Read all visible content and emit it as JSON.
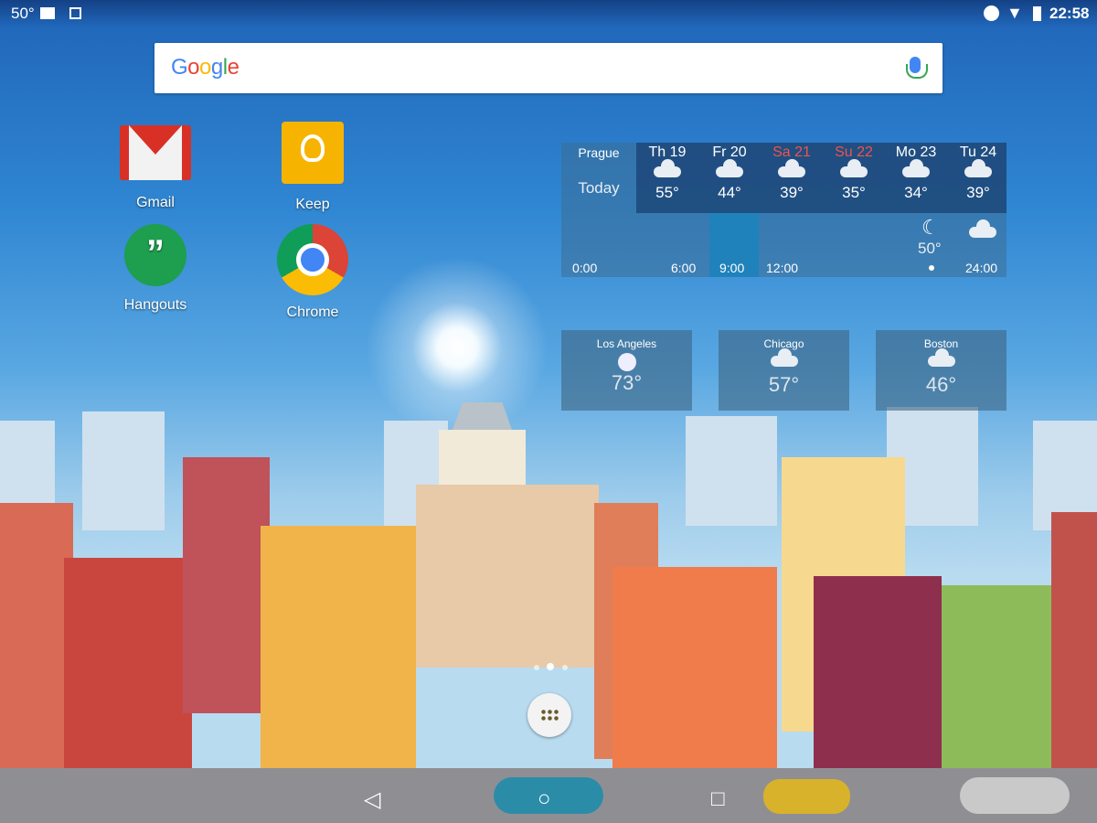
{
  "status_bar": {
    "temperature": "50°",
    "time": "22:58",
    "icons": [
      "gmail-notification-icon",
      "image-notification-icon",
      "do-not-disturb-icon",
      "wifi-icon",
      "battery-icon"
    ]
  },
  "search": {
    "logo": "Google",
    "icon": "mic-icon"
  },
  "apps": [
    {
      "label": "Gmail"
    },
    {
      "label": "Keep"
    },
    {
      "label": "Hangouts"
    },
    {
      "label": "Chrome"
    }
  ],
  "weather": {
    "city": "Prague",
    "today": "Today",
    "days": [
      {
        "label": "Th 19",
        "temp": "55°",
        "icon": "rain",
        "weekend": false
      },
      {
        "label": "Fr 20",
        "temp": "44°",
        "icon": "rain",
        "weekend": false
      },
      {
        "label": "Sa 21",
        "temp": "39°",
        "icon": "cloud",
        "weekend": true
      },
      {
        "label": "Su 22",
        "temp": "35°",
        "icon": "partly-sunny",
        "weekend": true
      },
      {
        "label": "Mo 23",
        "temp": "34°",
        "icon": "cloud",
        "weekend": false
      },
      {
        "label": "Tu 24",
        "temp": "39°",
        "icon": "cloud",
        "weekend": false
      }
    ],
    "now_temp": "50°",
    "hours": [
      "0:00",
      "6:00",
      "9:00",
      "12:00",
      "24:00"
    ],
    "weekend_color": "#ef5350"
  },
  "cities": [
    {
      "name": "Los Angeles",
      "temp": "73°",
      "icon": "sunny"
    },
    {
      "name": "Chicago",
      "temp": "57°",
      "icon": "cloud"
    },
    {
      "name": "Boston",
      "temp": "46°",
      "icon": "partly-sunny"
    }
  ],
  "nav": {
    "back": "◁",
    "home": "○",
    "recents": "□"
  },
  "page_indicator": {
    "pages": 3,
    "current": 1
  }
}
